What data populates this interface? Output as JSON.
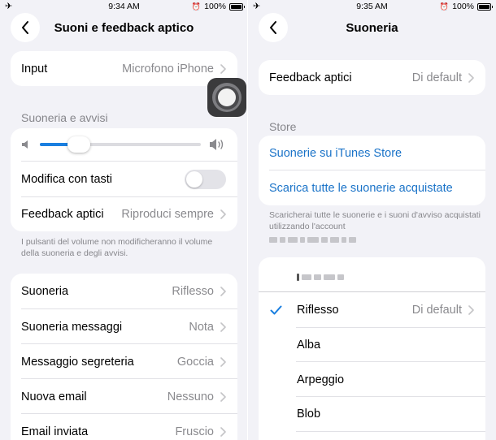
{
  "left": {
    "status": {
      "time": "9:34 AM",
      "battery": "100%"
    },
    "title": "Suoni e feedback aptico",
    "input_row": {
      "label": "Input",
      "value": "Microfono iPhone"
    },
    "ringer_section": {
      "header": "Suoneria e avvisi",
      "volume_level": 0.24,
      "change_with_buttons": {
        "label": "Modifica con tasti",
        "on": false
      },
      "haptics": {
        "label": "Feedback aptici",
        "value": "Riproduci sempre"
      }
    },
    "footnote": "I pulsanti del volume non modificheranno il volume della suoneria e degli avvisi.",
    "sounds": [
      {
        "label": "Suoneria",
        "value": "Riflesso"
      },
      {
        "label": "Suoneria messaggi",
        "value": "Nota"
      },
      {
        "label": "Messaggio segreteria",
        "value": "Goccia"
      },
      {
        "label": "Nuova email",
        "value": "Nessuno"
      },
      {
        "label": "Email inviata",
        "value": "Fruscio"
      }
    ]
  },
  "right": {
    "status": {
      "time": "9:35 AM",
      "battery": "100%"
    },
    "title": "Suoneria",
    "haptics": {
      "label": "Feedback aptici",
      "value": "Di default"
    },
    "store": {
      "header": "Store",
      "links": [
        "Suonerie su iTunes Store",
        "Scarica tutte le suonerie acquistate"
      ],
      "footnote": "Scaricherai tutte le suonerie e i suoni d'avviso acquistati utilizzando l'account"
    },
    "tones": [
      {
        "label": "Riflesso",
        "value": "Di default",
        "selected": true
      },
      {
        "label": "Alba",
        "value": "",
        "selected": false
      },
      {
        "label": "Arpeggio",
        "value": "",
        "selected": false
      },
      {
        "label": "Blob",
        "value": "",
        "selected": false
      }
    ]
  },
  "colors": {
    "accent": "#1a7fe0",
    "link": "#1a73c8",
    "background": "#f2f2f7",
    "secondary_text": "#8a8a8e"
  },
  "icons": [
    "airplane-icon",
    "alarm-icon",
    "battery-icon",
    "back-chevron-icon",
    "chevron-right-icon",
    "volume-low-icon",
    "volume-high-icon",
    "checkmark-icon",
    "assistive-touch-icon"
  ]
}
